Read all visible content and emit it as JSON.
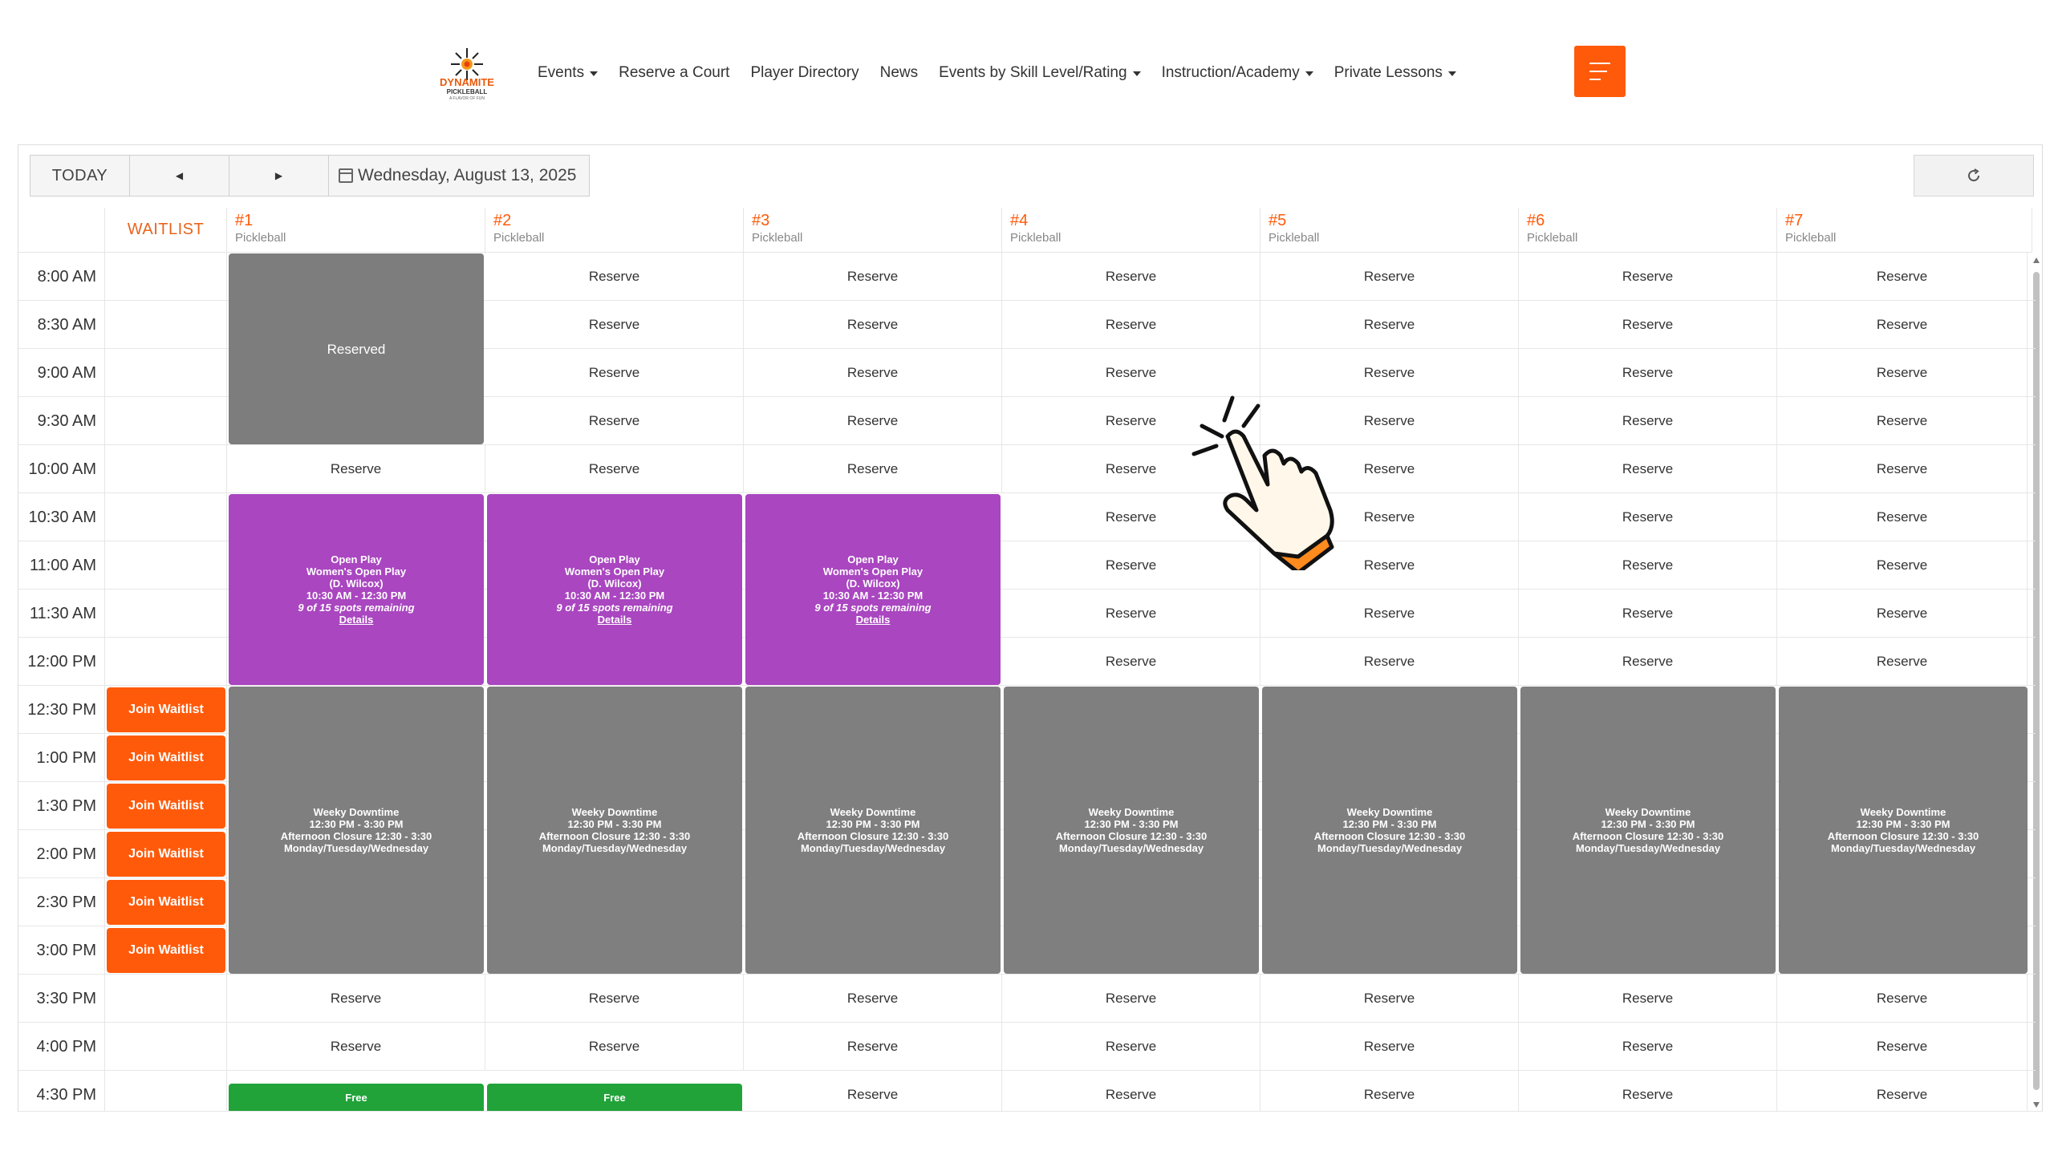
{
  "logo": {
    "word": "DYNAMITE",
    "sub": "PICKLEBALL",
    "tag": "A FLAVOR OF FUN"
  },
  "nav": {
    "items": [
      {
        "label": "Events",
        "dropdown": true
      },
      {
        "label": "Reserve a Court",
        "dropdown": false
      },
      {
        "label": "Player Directory",
        "dropdown": false
      },
      {
        "label": "News",
        "dropdown": false
      },
      {
        "label": "Events by Skill Level/Rating",
        "dropdown": true
      },
      {
        "label": "Instruction/Academy",
        "dropdown": true
      },
      {
        "label": "Private Lessons",
        "dropdown": true
      }
    ],
    "menu_icon": "hamburger-icon"
  },
  "toolbar": {
    "today": "TODAY",
    "prev": "◀",
    "next": "▶",
    "date": "Wednesday, August 13, 2025",
    "refresh_icon": "refresh-icon"
  },
  "waitlist_header": "WAITLIST",
  "courts": [
    {
      "num": "#1",
      "type": "Pickleball"
    },
    {
      "num": "#2",
      "type": "Pickleball"
    },
    {
      "num": "#3",
      "type": "Pickleball"
    },
    {
      "num": "#4",
      "type": "Pickleball"
    },
    {
      "num": "#5",
      "type": "Pickleball"
    },
    {
      "num": "#6",
      "type": "Pickleball"
    },
    {
      "num": "#7",
      "type": "Pickleball"
    }
  ],
  "times": [
    "8:00 AM",
    "8:30 AM",
    "9:00 AM",
    "9:30 AM",
    "10:00 AM",
    "10:30 AM",
    "11:00 AM",
    "11:30 AM",
    "12:00 PM",
    "12:30 PM",
    "1:00 PM",
    "1:30 PM",
    "2:00 PM",
    "2:30 PM",
    "3:00 PM",
    "3:30 PM",
    "4:00 PM",
    "4:30 PM"
  ],
  "reserve_label": "Reserve",
  "join_waitlist_label": "Join Waitlist",
  "reserved_label": "Reserved",
  "open_play": {
    "title": "Open Play",
    "name": "Women's Open Play",
    "host": "(D. Wilcox)",
    "time": "10:30 AM - 12:30 PM",
    "spots": "9 of 15 spots remaining",
    "details": "Details"
  },
  "downtime": {
    "title": "Weeky Downtime",
    "time": "12:30 PM - 3:30 PM",
    "desc": "Afternoon Closure 12:30 - 3:30",
    "days": "Monday/Tuesday/Wednesday"
  },
  "free_label": "Free",
  "colors": {
    "accent": "#ff5a0a",
    "open_play": "#a946c0",
    "blocked": "#7f7f7f",
    "free": "#21a33a"
  }
}
